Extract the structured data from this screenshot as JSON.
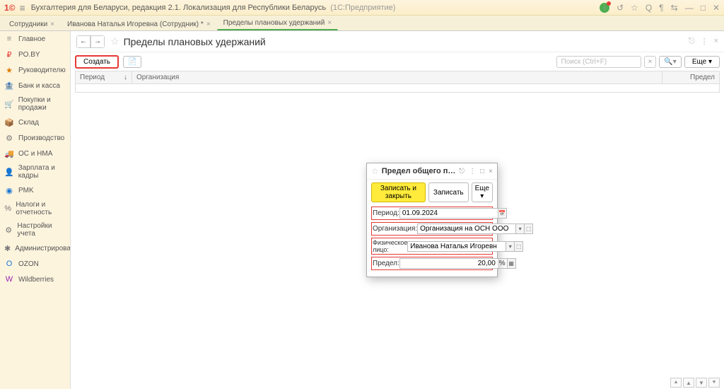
{
  "titlebar": {
    "app_title": "Бухгалтерия для Беларуси, редакция 2.1. Локализация для Республики Беларусь",
    "app_suffix": "(1С:Предприятие)"
  },
  "tabs": [
    {
      "label": "Сотрудники",
      "active": false
    },
    {
      "label": "Иванова Наталья Игоревна (Сотрудник) *",
      "active": false
    },
    {
      "label": "Пределы плановых удержаний",
      "active": true
    }
  ],
  "sidebar": [
    {
      "icon": "≡",
      "label": "Главное",
      "color": "#888"
    },
    {
      "icon": "₽",
      "label": "PO.BY",
      "color": "#e53935"
    },
    {
      "icon": "★",
      "label": "Руководителю",
      "color": "#e07b00"
    },
    {
      "icon": "🏦",
      "label": "Банк и касса",
      "color": "#4caf50"
    },
    {
      "icon": "🛒",
      "label": "Покупки и продажи",
      "color": "#777"
    },
    {
      "icon": "📦",
      "label": "Склад",
      "color": "#777"
    },
    {
      "icon": "⚙",
      "label": "Производство",
      "color": "#777"
    },
    {
      "icon": "🚚",
      "label": "ОС и НМА",
      "color": "#777"
    },
    {
      "icon": "👤",
      "label": "Зарплата и кадры",
      "color": "#777"
    },
    {
      "icon": "◉",
      "label": "PMK",
      "color": "#1976d2"
    },
    {
      "icon": "%",
      "label": "Налоги и отчетность",
      "color": "#777"
    },
    {
      "icon": "⚙",
      "label": "Настройки учета",
      "color": "#777"
    },
    {
      "icon": "✱",
      "label": "Администрирование",
      "color": "#777"
    },
    {
      "icon": "O",
      "label": "OZON",
      "color": "#1976d2"
    },
    {
      "icon": "W",
      "label": "Wildberries",
      "color": "#9c27b0"
    }
  ],
  "page": {
    "title": "Пределы плановых удержаний",
    "create_btn": "Создать",
    "search_placeholder": "Поиск (Ctrl+F)",
    "more_btn": "Еще",
    "columns": {
      "period": "Период",
      "org": "Организация",
      "limit": "Предел"
    }
  },
  "dialog": {
    "title": "Предел общего п…",
    "save_close": "Записать и закрыть",
    "save": "Записать",
    "more": "Еще",
    "fields": {
      "period_label": "Период:",
      "period_value": "01.09.2024",
      "org_label": "Организация:",
      "org_value": "Организация на ОСН ООО",
      "person_label": "Физическое лицо:",
      "person_value": "Иванова Наталья Игоревн",
      "limit_label": "Предел:",
      "limit_value": "20,00",
      "limit_suffix": "%"
    }
  }
}
